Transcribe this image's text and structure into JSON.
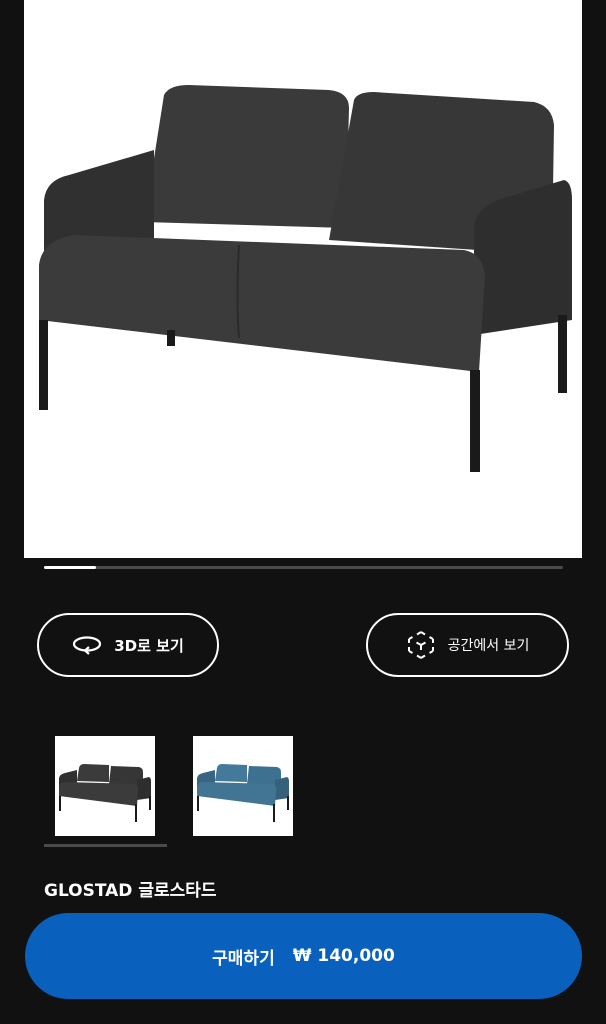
{
  "product": {
    "image_icon": "sofa-image",
    "name": "GLOSTAD 글로스타드",
    "image_index": 1,
    "image_count": 10
  },
  "actions": {
    "view_3d_label": "3D로 보기",
    "view_3d_icon": "rotate-icon",
    "view_ar_label": "공간에서 보기",
    "view_ar_icon": "ar-cube-icon"
  },
  "variants": [
    {
      "name": "dark-grey",
      "color": "#3b3b3b",
      "selected": true
    },
    {
      "name": "blue",
      "color": "#3e6f8c",
      "selected": false
    }
  ],
  "purchase": {
    "label": "구매하기",
    "price": "₩ 140,000"
  },
  "colors": {
    "background": "#111111",
    "accent_blue": "#0a60bd"
  }
}
